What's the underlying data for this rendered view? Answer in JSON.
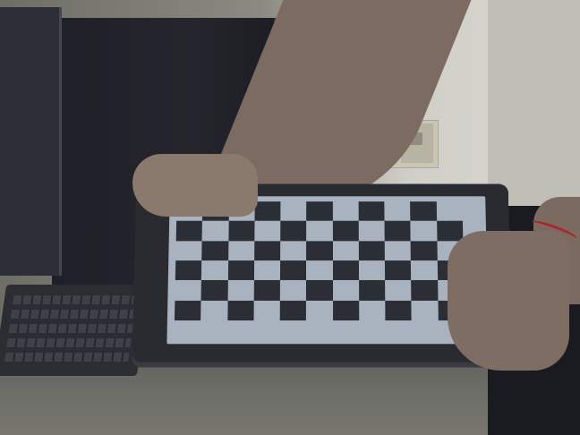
{
  "scene": {
    "description_free": true,
    "palette": {
      "wall": "#cfcfc8",
      "desk": "#6a6a64",
      "computer": "#1f2027",
      "tablet_frame": "#2a2b30",
      "screen_light": "#a9b3c0",
      "screen_dark": "#2c2e36",
      "skin": "#7d6d62",
      "shirt": "#bfbfb8",
      "wristband": "#b0232b"
    },
    "checkerboard": {
      "columns": 11,
      "rows": 6
    }
  }
}
